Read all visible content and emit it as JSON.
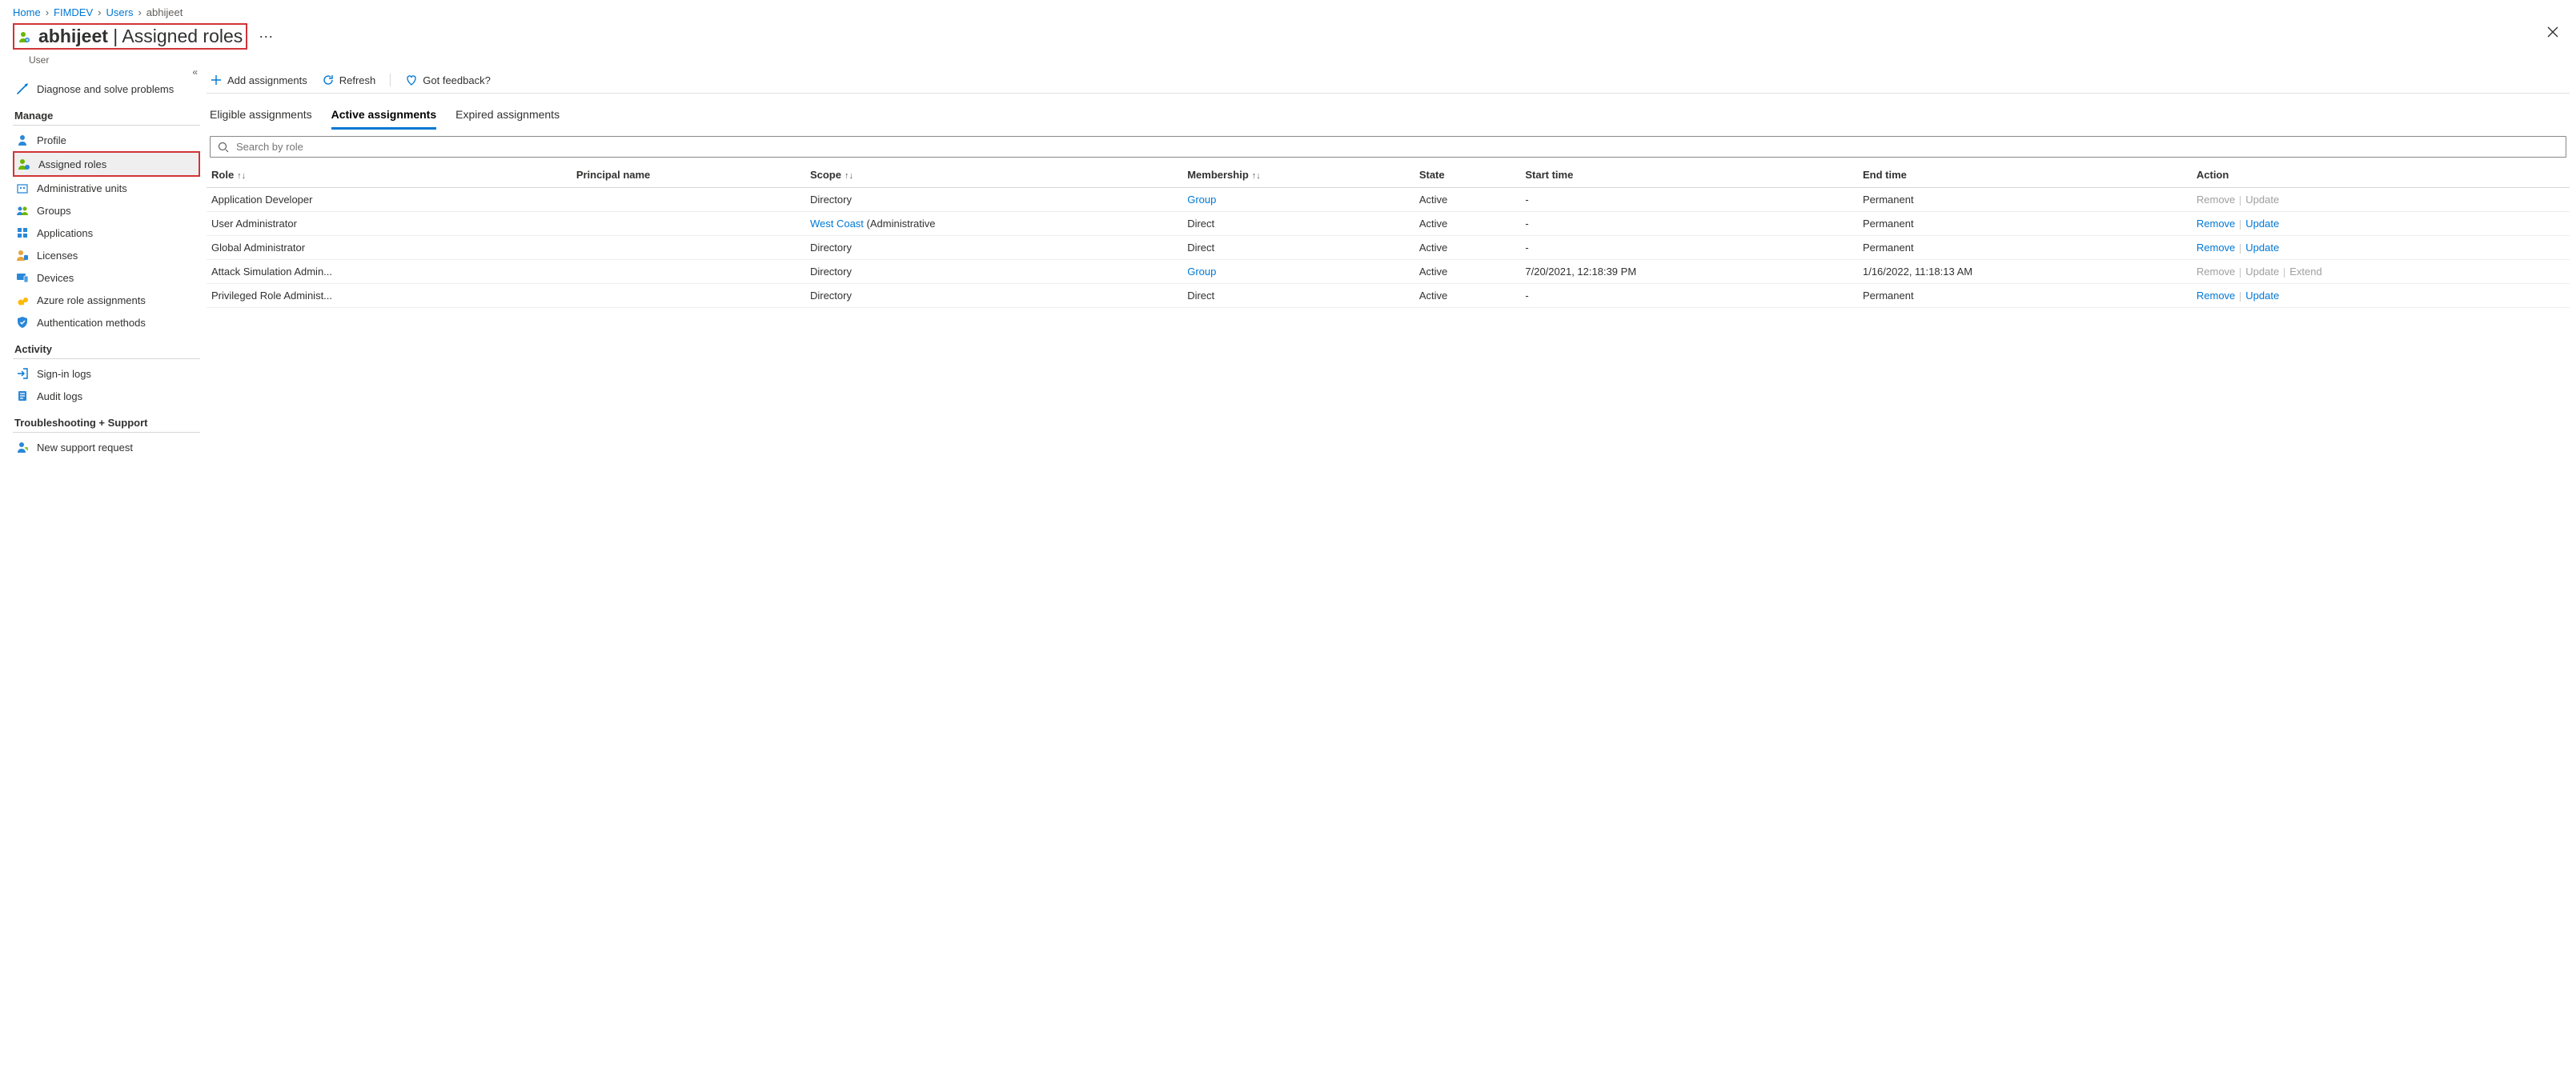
{
  "breadcrumbs": [
    "Home",
    "FIMDEV",
    "Users",
    "abhijeet"
  ],
  "header": {
    "user_name": "abhijeet",
    "page_name": "Assigned roles",
    "subtitle": "User"
  },
  "sidebar": {
    "top_item": {
      "label": "Diagnose and solve problems"
    },
    "sections": [
      {
        "title": "Manage",
        "items": [
          {
            "key": "profile",
            "label": "Profile"
          },
          {
            "key": "assigned-roles",
            "label": "Assigned roles",
            "selected": true
          },
          {
            "key": "administrative-units",
            "label": "Administrative units"
          },
          {
            "key": "groups",
            "label": "Groups"
          },
          {
            "key": "applications",
            "label": "Applications"
          },
          {
            "key": "licenses",
            "label": "Licenses"
          },
          {
            "key": "devices",
            "label": "Devices"
          },
          {
            "key": "azure-role-assignments",
            "label": "Azure role assignments"
          },
          {
            "key": "authentication-methods",
            "label": "Authentication methods"
          }
        ]
      },
      {
        "title": "Activity",
        "items": [
          {
            "key": "signin-logs",
            "label": "Sign-in logs"
          },
          {
            "key": "audit-logs",
            "label": "Audit logs"
          }
        ]
      },
      {
        "title": "Troubleshooting + Support",
        "items": [
          {
            "key": "new-support-request",
            "label": "New support request"
          }
        ]
      }
    ]
  },
  "commands": {
    "add": "Add assignments",
    "refresh": "Refresh",
    "feedback": "Got feedback?"
  },
  "tabs": [
    "Eligible assignments",
    "Active assignments",
    "Expired assignments"
  ],
  "active_tab_index": 1,
  "search": {
    "placeholder": "Search by role"
  },
  "columns": [
    "Role",
    "Principal name",
    "Scope",
    "Membership",
    "State",
    "Start time",
    "End time",
    "Action"
  ],
  "actions": {
    "remove": "Remove",
    "update": "Update",
    "extend": "Extend"
  },
  "rows": [
    {
      "role": "Application Developer",
      "principal_name": "",
      "scope": "Directory",
      "scope_link": false,
      "scope_suffix": "",
      "membership": "Group",
      "membership_link": true,
      "state": "Active",
      "start": "-",
      "end": "Permanent",
      "action_remove_enabled": false,
      "action_update_enabled": false,
      "action_extend_enabled": false,
      "show_extend": false
    },
    {
      "role": "User Administrator",
      "principal_name": "",
      "scope": "West Coast",
      "scope_link": true,
      "scope_suffix": " (Administrative",
      "membership": "Direct",
      "membership_link": false,
      "state": "Active",
      "start": "-",
      "end": "Permanent",
      "action_remove_enabled": true,
      "action_update_enabled": true,
      "action_extend_enabled": false,
      "show_extend": false
    },
    {
      "role": "Global Administrator",
      "principal_name": "",
      "scope": "Directory",
      "scope_link": false,
      "scope_suffix": "",
      "membership": "Direct",
      "membership_link": false,
      "state": "Active",
      "start": "-",
      "end": "Permanent",
      "action_remove_enabled": true,
      "action_update_enabled": true,
      "action_extend_enabled": false,
      "show_extend": false
    },
    {
      "role": "Attack Simulation Admin...",
      "principal_name": "",
      "scope": "Directory",
      "scope_link": false,
      "scope_suffix": "",
      "membership": "Group",
      "membership_link": true,
      "state": "Active",
      "start": "7/20/2021, 12:18:39 PM",
      "end": "1/16/2022, 11:18:13 AM",
      "action_remove_enabled": false,
      "action_update_enabled": false,
      "action_extend_enabled": false,
      "show_extend": true
    },
    {
      "role": "Privileged Role Administ...",
      "principal_name": "",
      "scope": "Directory",
      "scope_link": false,
      "scope_suffix": "",
      "membership": "Direct",
      "membership_link": false,
      "state": "Active",
      "start": "-",
      "end": "Permanent",
      "action_remove_enabled": true,
      "action_update_enabled": true,
      "action_extend_enabled": false,
      "show_extend": false
    }
  ]
}
